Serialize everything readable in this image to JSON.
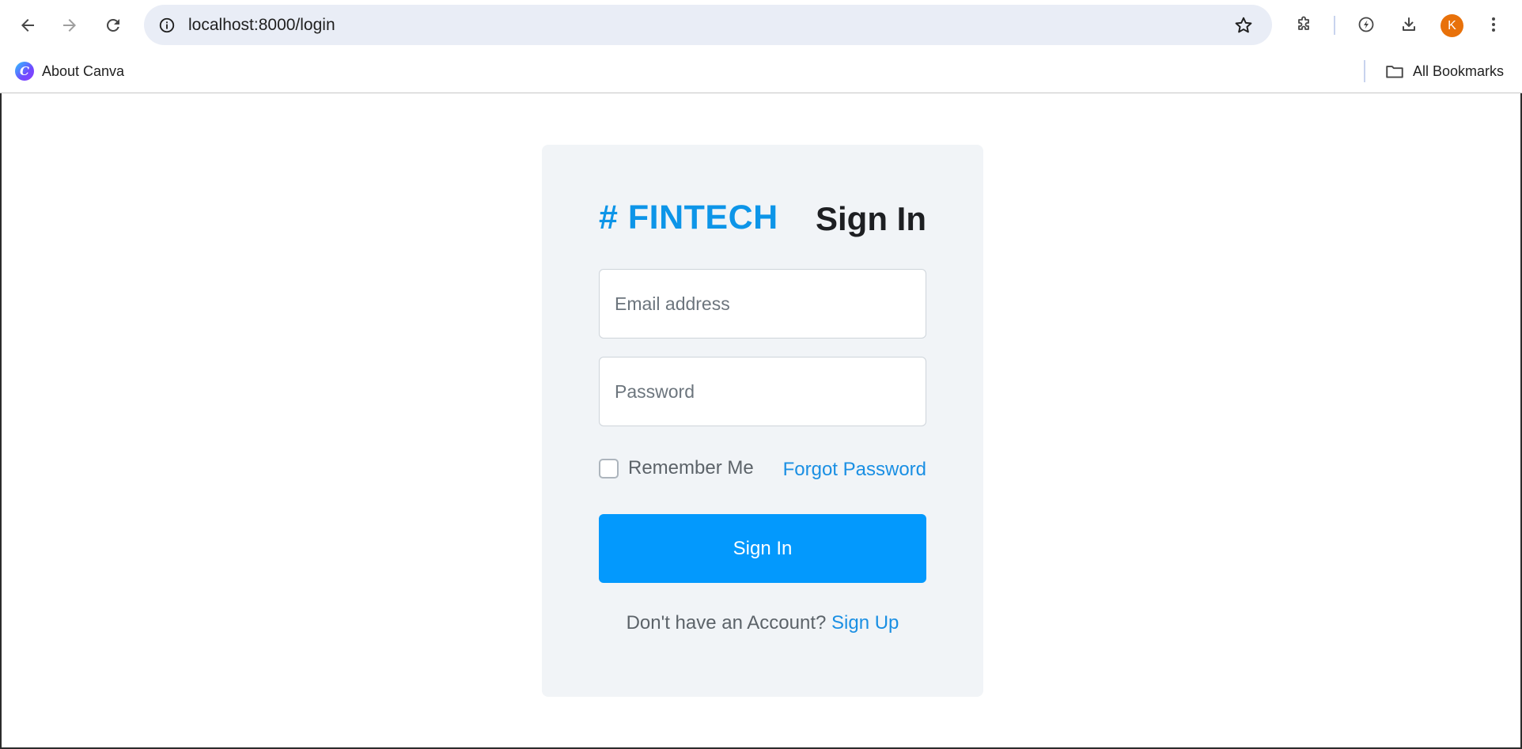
{
  "browser": {
    "url": "localhost:8000/login",
    "avatar_letter": "K",
    "bookmarks": [
      {
        "label": "About Canva",
        "icon": "canva-logo-icon",
        "logo_letter": "C"
      }
    ],
    "all_bookmarks_label": "All Bookmarks"
  },
  "login": {
    "brand": "# FINTECH",
    "title": "Sign In",
    "email_placeholder": "Email address",
    "password_placeholder": "Password",
    "remember_label": "Remember Me",
    "forgot_label": "Forgot Password",
    "submit_label": "Sign In",
    "no_account_text": "Don't have an Account?",
    "signup_label": "Sign Up"
  },
  "colors": {
    "brand": "#0d95e8",
    "primary_button": "#0399fd",
    "link": "#1a8fe3",
    "card_background": "#f1f4f7",
    "avatar": "#e8710a"
  }
}
